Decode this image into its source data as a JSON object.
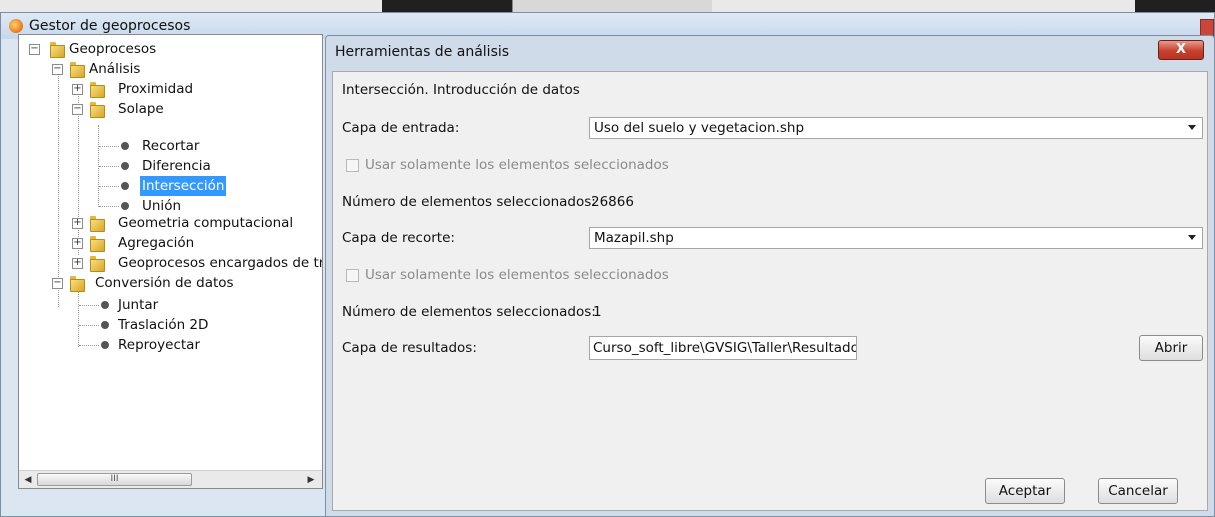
{
  "window": {
    "title": "Gestor de geoprocesos"
  },
  "tree": {
    "root": "Geoprocesos",
    "analisis": "Análisis",
    "proximidad": "Proximidad",
    "solape": "Solape",
    "recortar": "Recortar",
    "diferencia": "Diferencia",
    "interseccion": "Intersección",
    "union": "Unión",
    "geometria": "Geometria computacional",
    "agregacion": "Agregación",
    "encargados": "Geoprocesos encargados de tran",
    "conversion": "Conversión de datos",
    "juntar": "Juntar",
    "traslacion": "Traslación 2D",
    "reproyectar": "Reproyectar",
    "scroll_grip": "III"
  },
  "dialog": {
    "title": "Herramientas de análisis",
    "close_label": "X",
    "heading": "Intersección. Introducción de datos",
    "input_layer_label": "Capa de entrada:",
    "input_layer_value": "Uso del suelo y vegetacion.shp",
    "use_selected_label_1": "Usar solamente los elementos seleccionados",
    "num_selected_label_1": "Número de elementos seleccionados:",
    "num_selected_value_1": "26866",
    "clip_layer_label": "Capa de recorte:",
    "clip_layer_value": "Mazapil.shp",
    "use_selected_label_2": "Usar solamente los elementos seleccionados",
    "num_selected_label_2": "Número de elementos seleccionados:",
    "num_selected_value_2": "1",
    "result_layer_label": "Capa de resultados:",
    "result_layer_value": "Curso_soft_libre\\GVSIG\\Taller\\Resultados",
    "open_button": "Abrir",
    "accept_button": "Aceptar",
    "cancel_button": "Cancelar"
  }
}
